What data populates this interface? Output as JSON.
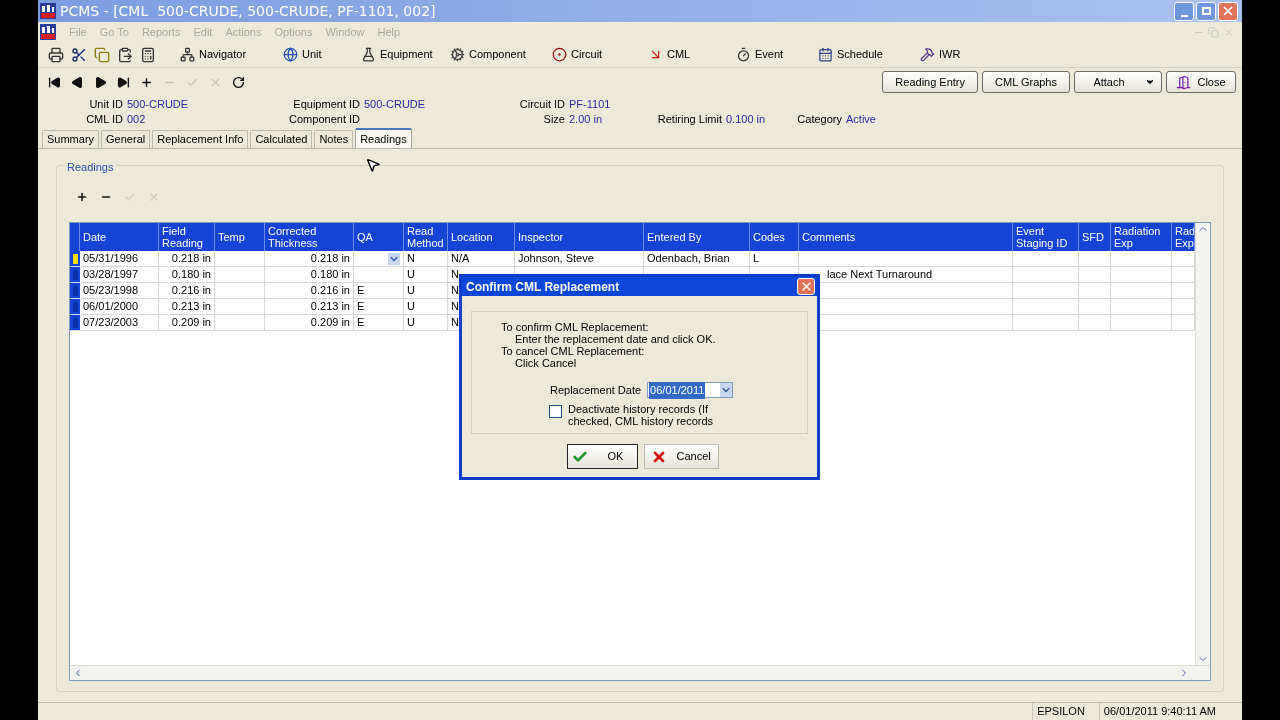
{
  "window": {
    "title": "PCMS - [CML  500-CRUDE, 500-CRUDE, PF-1101, 002]"
  },
  "menu": [
    {
      "label": "File",
      "disabled": true
    },
    {
      "label": "Go To",
      "disabled": true
    },
    {
      "label": "Reports",
      "disabled": true
    },
    {
      "label": "Edit",
      "disabled": true
    },
    {
      "label": "Actions",
      "disabled": true
    },
    {
      "label": "Options",
      "disabled": true
    },
    {
      "label": "Window",
      "disabled": true
    },
    {
      "label": "Help",
      "disabled": true
    }
  ],
  "toolbar": [
    {
      "label": "Navigator"
    },
    {
      "label": "Unit"
    },
    {
      "label": "Equipment"
    },
    {
      "label": "Component"
    },
    {
      "label": "Circuit"
    },
    {
      "label": "CML"
    },
    {
      "label": "Event"
    },
    {
      "label": "Schedule"
    },
    {
      "label": "IWR"
    }
  ],
  "record_nav": [
    {
      "disabled": false
    },
    {
      "disabled": false
    },
    {
      "disabled": false
    },
    {
      "disabled": false
    },
    {
      "disabled": false
    },
    {
      "disabled": true
    },
    {
      "disabled": true
    },
    {
      "disabled": true
    },
    {
      "disabled": false
    }
  ],
  "action_buttons": [
    {
      "label": "Reading Entry",
      "kind": "plain"
    },
    {
      "label": "CML Graphs",
      "kind": "plain"
    },
    {
      "label": "Attach",
      "kind": "dropdown"
    },
    {
      "label": "Close",
      "kind": "exit"
    }
  ],
  "header_fields": [
    [
      {
        "label": "Unit ID",
        "value": "500-CRUDE"
      },
      {
        "label": "Equipment ID",
        "value": "500-CRUDE"
      },
      {
        "label": "Circuit ID",
        "value": "PF-1101"
      }
    ],
    [
      {
        "label": "CML ID",
        "value": "002"
      },
      {
        "label": "Component ID"
      },
      {
        "label": "Size",
        "value": "2.00 in"
      },
      {
        "label": "Retiring Limit",
        "value": "0.100 in"
      },
      {
        "label": "Category",
        "value": "Active"
      }
    ]
  ],
  "tabs": [
    {
      "label": "Summary",
      "selected": false
    },
    {
      "label": "General",
      "selected": false
    },
    {
      "label": "Replacement Info",
      "selected": false
    },
    {
      "label": "Calculated",
      "selected": false
    },
    {
      "label": "Notes",
      "selected": false
    },
    {
      "label": "Readings",
      "selected": true
    }
  ],
  "readings": {
    "title": "Readings",
    "toolbar": [
      {
        "disabled": false
      },
      {
        "disabled": false
      },
      {
        "disabled": true
      },
      {
        "disabled": true
      }
    ],
    "columns": [
      "Date",
      "Field Reading",
      "Temp",
      "Corrected Thickness",
      "QA",
      "Read Method",
      "Location",
      "Inspector",
      "Entered By",
      "Codes",
      "Comments",
      "Event Staging ID",
      "SFD",
      "Radiation Exp",
      "Rad Exp"
    ],
    "rows": [
      {
        "selected": true,
        "cells": [
          "05/31/1996",
          "0.218 in",
          null,
          "0.218 in",
          null,
          "N",
          "N/A",
          "Johnson, Steve",
          "Odenbach, Brian",
          "L",
          null,
          null,
          null,
          null,
          null
        ]
      },
      {
        "selected": false,
        "cells": [
          "03/28/1997",
          "0.180 in",
          null,
          "0.180 in",
          null,
          "U",
          "N",
          null,
          null,
          null,
          "lace Next Turnaround",
          null,
          null,
          null,
          null
        ]
      },
      {
        "selected": false,
        "cells": [
          "05/23/1998",
          "0.216 in",
          null,
          "0.216 in",
          "E",
          "U",
          "N",
          null,
          null,
          null,
          null,
          null,
          null,
          null,
          null
        ]
      },
      {
        "selected": false,
        "cells": [
          "06/01/2000",
          "0.213 in",
          null,
          "0.213 in",
          "E",
          "U",
          "N",
          null,
          null,
          null,
          null,
          null,
          null,
          null,
          null
        ]
      },
      {
        "selected": false,
        "cells": [
          "07/23/2003",
          "0.209 in",
          null,
          "0.209 in",
          "E",
          "U",
          "N",
          null,
          null,
          null,
          null,
          null,
          null,
          null,
          null
        ]
      }
    ]
  },
  "dialog": {
    "title": "Confirm CML Replacement",
    "instructions": [
      {
        "kind": "heading",
        "text": "To confirm CML Replacement:"
      },
      {
        "kind": "step",
        "text": "Enter the replacement date and click OK."
      },
      {
        "kind": "heading",
        "text": "To cancel CML Replacement:"
      },
      {
        "kind": "step",
        "text": "Click Cancel"
      }
    ],
    "date_label": "Replacement Date",
    "date_value": "06/01/2011",
    "checkbox": {
      "label": "Deactivate history records (If checked, CML history records",
      "checked": false
    },
    "buttons": [
      {
        "label": "OK",
        "kind": "ok"
      },
      {
        "label": "Cancel",
        "kind": "cancel"
      }
    ]
  },
  "status_bar": [
    "EPSILON",
    "06/01/2011 9:40:11 AM"
  ]
}
